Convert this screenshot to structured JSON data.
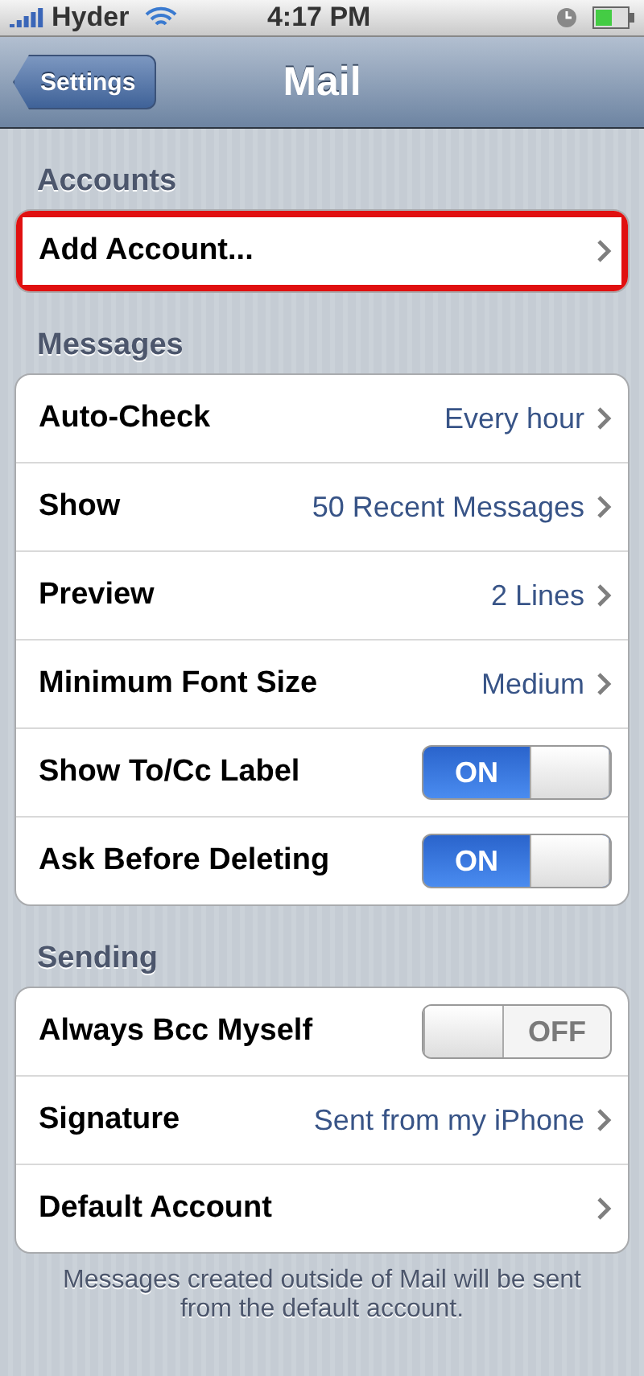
{
  "status_bar": {
    "carrier": "Hyder",
    "time": "4:17 PM"
  },
  "nav": {
    "back": "Settings",
    "title": "Mail"
  },
  "sections": [
    {
      "header": "Accounts",
      "rows": [
        {
          "kind": "link",
          "label": "Add Account...",
          "highlighted": true
        }
      ]
    },
    {
      "header": "Messages",
      "rows": [
        {
          "kind": "value",
          "label": "Auto-Check",
          "value": "Every hour"
        },
        {
          "kind": "value",
          "label": "Show",
          "value": "50 Recent Messages"
        },
        {
          "kind": "value",
          "label": "Preview",
          "value": "2 Lines"
        },
        {
          "kind": "value",
          "label": "Minimum Font Size",
          "value": "Medium"
        },
        {
          "kind": "switch",
          "label": "Show To/Cc Label",
          "on": true,
          "switch_text": "ON"
        },
        {
          "kind": "switch",
          "label": "Ask Before Deleting",
          "on": true,
          "switch_text": "ON"
        }
      ]
    },
    {
      "header": "Sending",
      "rows": [
        {
          "kind": "switch",
          "label": "Always Bcc Myself",
          "on": false,
          "switch_text": "OFF"
        },
        {
          "kind": "value",
          "label": "Signature",
          "value": "Sent from my iPhone"
        },
        {
          "kind": "link",
          "label": "Default Account"
        }
      ],
      "footer": "Messages created outside of Mail will be sent from the default account."
    }
  ]
}
